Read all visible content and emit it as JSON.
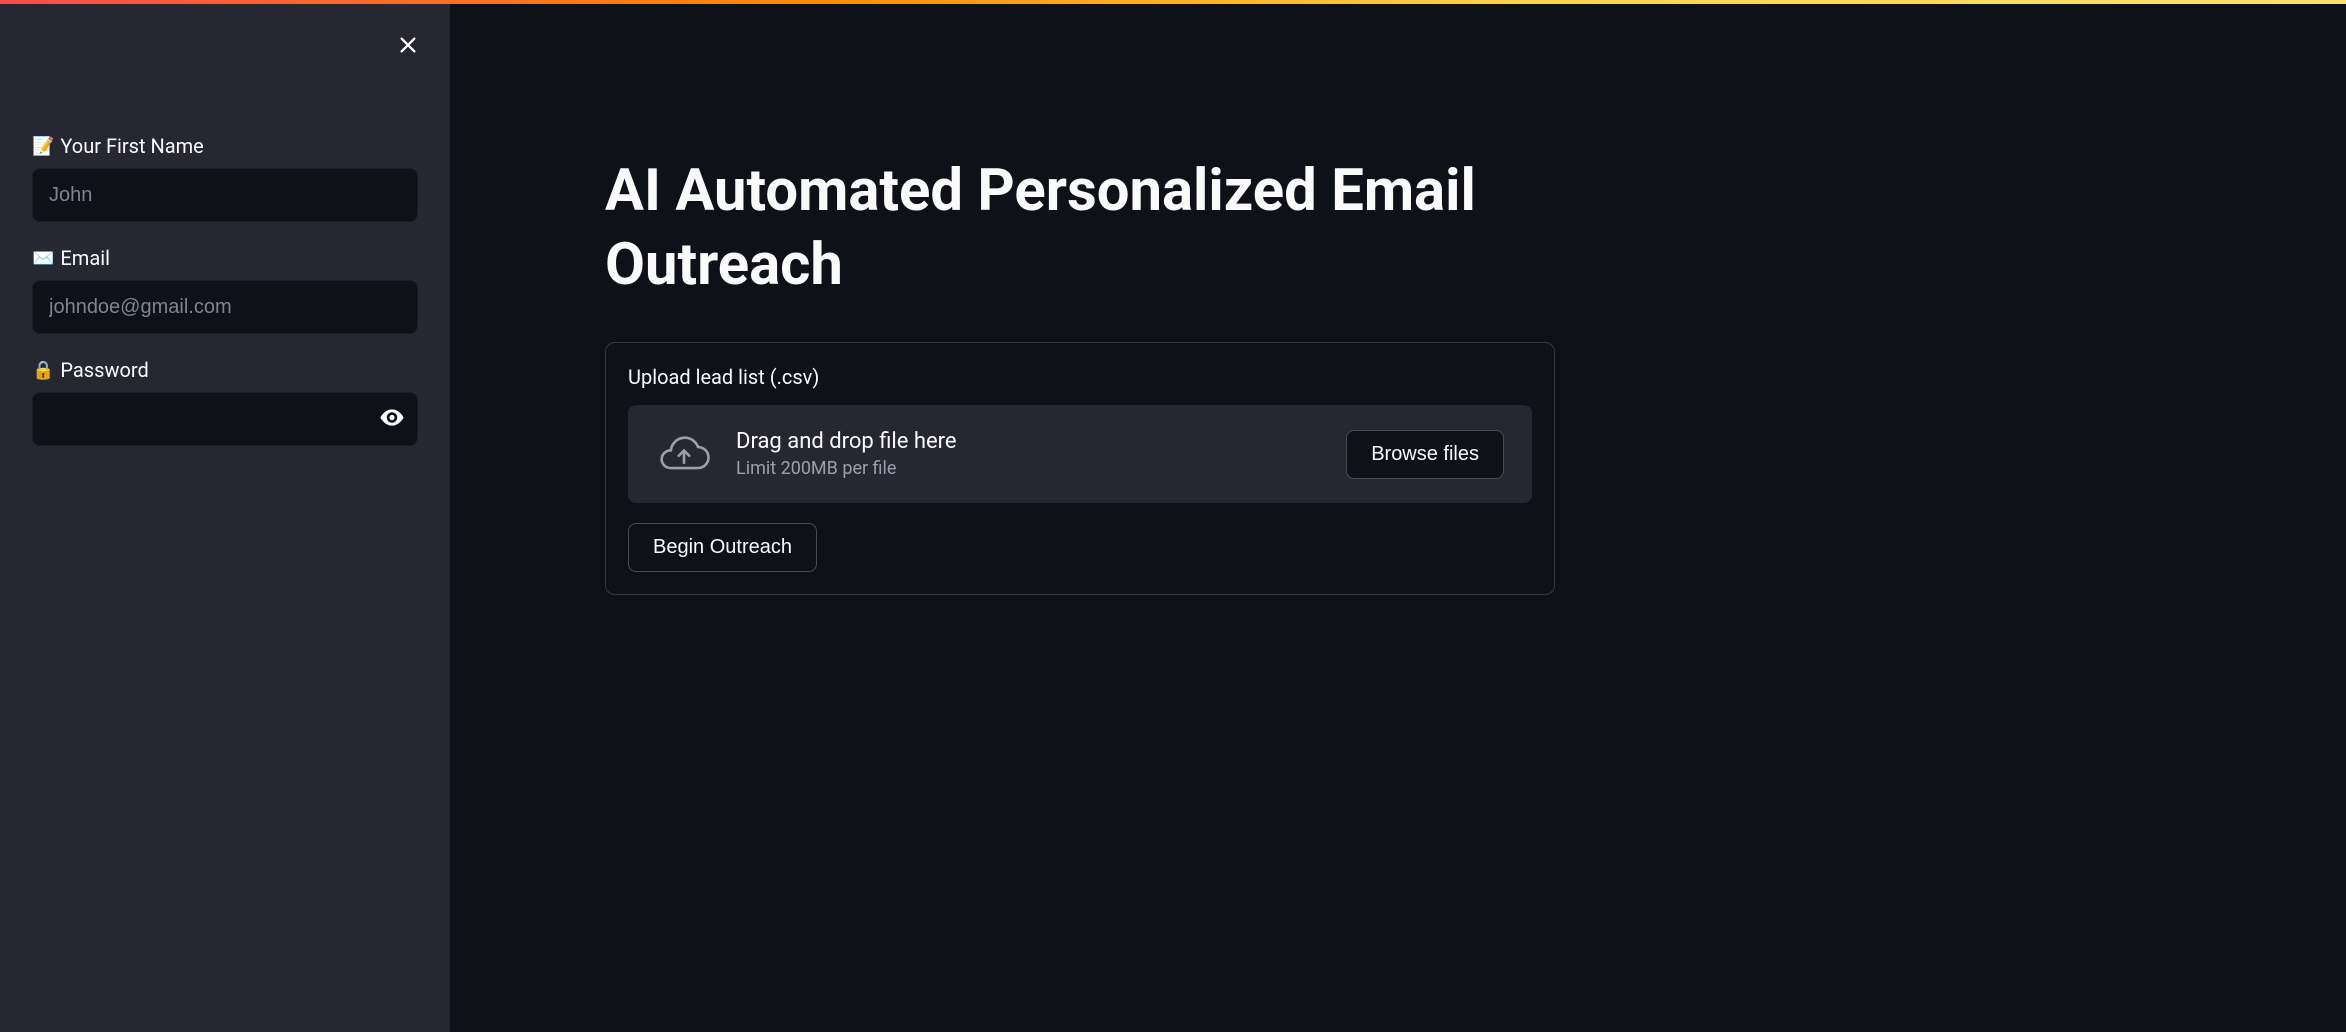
{
  "sidebar": {
    "fields": {
      "first_name": {
        "icon": "📝",
        "label": "Your First Name",
        "placeholder": "John",
        "value": ""
      },
      "email": {
        "icon": "✉️",
        "label": "Email",
        "placeholder": "johndoe@gmail.com",
        "value": ""
      },
      "password": {
        "icon": "🔒",
        "label": "Password",
        "placeholder": "",
        "value": ""
      }
    }
  },
  "main": {
    "title": "AI Automated Personalized Email Outreach",
    "upload": {
      "label": "Upload lead list (.csv)",
      "drop_text": "Drag and drop file here",
      "limit_text": "Limit 200MB per file",
      "browse_label": "Browse files"
    },
    "action_label": "Begin Outreach"
  }
}
